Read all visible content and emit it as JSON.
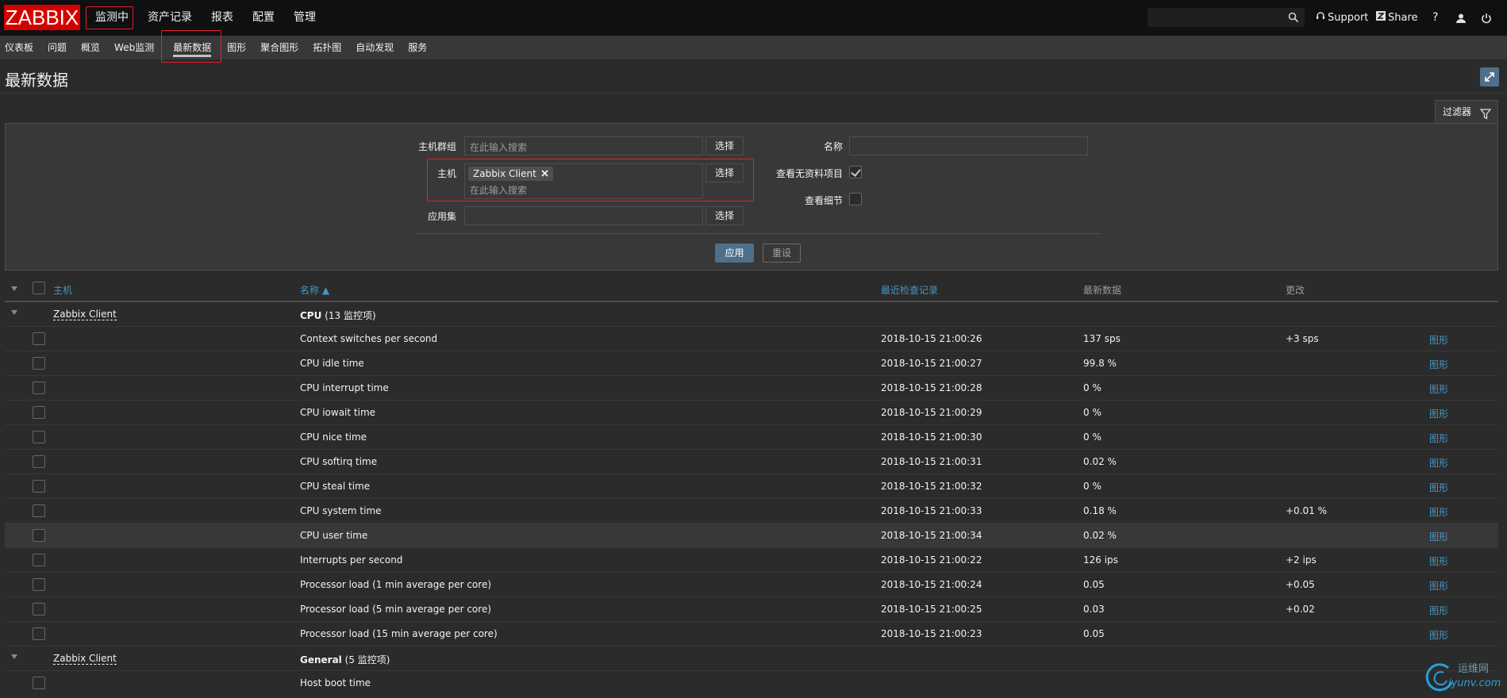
{
  "logo": "ZABBIX",
  "main_menu": [
    "监测中",
    "资产记录",
    "报表",
    "配置",
    "管理"
  ],
  "search": {
    "placeholder": ""
  },
  "top_links": {
    "support": "Support",
    "share": "Share",
    "help": "?"
  },
  "sub_menu": [
    "仪表板",
    "问题",
    "概览",
    "Web监测",
    "最新数据",
    "图形",
    "聚合图形",
    "拓扑图",
    "自动发现",
    "服务"
  ],
  "page_title": "最新数据",
  "filter": {
    "tab_label": "过滤器",
    "host_group_label": "主机群组",
    "host_group_placeholder": "在此输入搜索",
    "host_label": "主机",
    "host_tag": "Zabbix Client",
    "host_placeholder": "在此输入搜索",
    "application_label": "应用集",
    "select_label": "选择",
    "name_label": "名称",
    "show_items_without_data_label": "查看无资料项目",
    "show_items_without_data": true,
    "show_details_label": "查看细节",
    "show_details": false,
    "apply_label": "应用",
    "reset_label": "重设"
  },
  "table": {
    "headers": {
      "host": "主机",
      "name": "名称 ▲",
      "last_check": "最近检查记录",
      "last_value": "最新数据",
      "change": "更改"
    },
    "groups": [
      {
        "host": "Zabbix Client",
        "app": "CPU",
        "count": "(13 监控项)"
      },
      {
        "host": "Zabbix Client",
        "app": "General",
        "count": "(5 监控项)"
      }
    ],
    "rows": [
      {
        "name": "Context switches per second",
        "time": "2018-10-15 21:00:26",
        "value": "137 sps",
        "change": "+3 sps",
        "graph": "图形"
      },
      {
        "name": "CPU idle time",
        "time": "2018-10-15 21:00:27",
        "value": "99.8 %",
        "change": "",
        "graph": "图形"
      },
      {
        "name": "CPU interrupt time",
        "time": "2018-10-15 21:00:28",
        "value": "0 %",
        "change": "",
        "graph": "图形"
      },
      {
        "name": "CPU iowait time",
        "time": "2018-10-15 21:00:29",
        "value": "0 %",
        "change": "",
        "graph": "图形"
      },
      {
        "name": "CPU nice time",
        "time": "2018-10-15 21:00:30",
        "value": "0 %",
        "change": "",
        "graph": "图形"
      },
      {
        "name": "CPU softirq time",
        "time": "2018-10-15 21:00:31",
        "value": "0.02 %",
        "change": "",
        "graph": "图形"
      },
      {
        "name": "CPU steal time",
        "time": "2018-10-15 21:00:32",
        "value": "0 %",
        "change": "",
        "graph": "图形"
      },
      {
        "name": "CPU system time",
        "time": "2018-10-15 21:00:33",
        "value": "0.18 %",
        "change": "+0.01 %",
        "graph": "图形"
      },
      {
        "name": "CPU user time",
        "time": "2018-10-15 21:00:34",
        "value": "0.02 %",
        "change": "",
        "graph": "图形"
      },
      {
        "name": "Interrupts per second",
        "time": "2018-10-15 21:00:22",
        "value": "126 ips",
        "change": "+2 ips",
        "graph": "图形"
      },
      {
        "name": "Processor load (1 min average per core)",
        "time": "2018-10-15 21:00:24",
        "value": "0.05",
        "change": "+0.05",
        "graph": "图形"
      },
      {
        "name": "Processor load (5 min average per core)",
        "time": "2018-10-15 21:00:25",
        "value": "0.03",
        "change": "+0.02",
        "graph": "图形"
      },
      {
        "name": "Processor load (15 min average per core)",
        "time": "2018-10-15 21:00:23",
        "value": "0.05",
        "change": "",
        "graph": "图形"
      }
    ],
    "general_rows": [
      {
        "name": "Host boot time"
      }
    ]
  },
  "watermark": {
    "line1": "运维网",
    "line2": "iyunv.com"
  }
}
